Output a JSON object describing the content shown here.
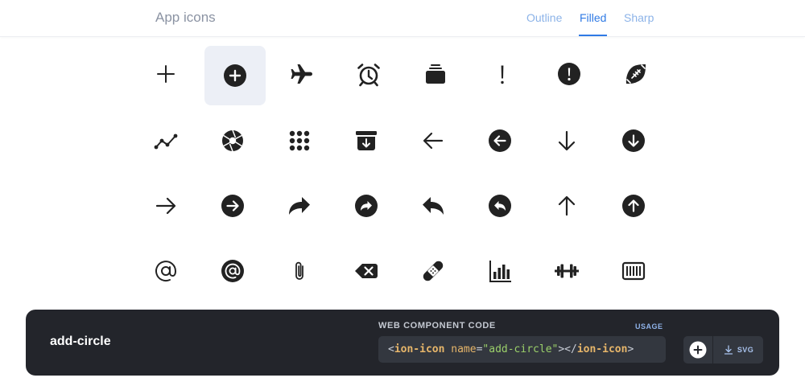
{
  "header": {
    "title": "App icons",
    "tabs": [
      {
        "label": "Outline",
        "active": false
      },
      {
        "label": "Filled",
        "active": true
      },
      {
        "label": "Sharp",
        "active": false
      }
    ]
  },
  "grid": {
    "selected_index": 1,
    "icons": [
      "add-icon",
      "add-circle-icon",
      "airplane-icon",
      "alarm-icon",
      "albums-icon",
      "alert-icon",
      "alert-circle-icon",
      "american-football-icon",
      "analytics-icon",
      "aperture-icon",
      "apps-icon",
      "archive-icon",
      "arrow-back-icon",
      "arrow-back-circle-icon",
      "arrow-down-icon",
      "arrow-down-circle-icon",
      "arrow-forward-icon",
      "arrow-forward-circle-icon",
      "arrow-redo-icon",
      "arrow-redo-circle-icon",
      "arrow-undo-icon",
      "arrow-undo-circle-icon",
      "arrow-up-icon",
      "arrow-up-circle-icon",
      "at-icon",
      "at-circle-icon",
      "attach-icon",
      "backspace-icon",
      "bandage-icon",
      "bar-chart-icon",
      "barbell-icon",
      "barcode-icon"
    ]
  },
  "detail": {
    "icon_name": "add-circle",
    "code_label": "WEB COMPONENT CODE",
    "usage_label": "USAGE",
    "code": {
      "open_bracket": "<",
      "tag": "ion-icon",
      "attr": "name",
      "equals": "=",
      "value": "\"add-circle\"",
      "close_open": "></",
      "close_tag": "ion-icon",
      "close_bracket": ">"
    },
    "download_label": "SVG"
  },
  "colors": {
    "accent": "#2f7ae5",
    "icon": "#222222",
    "panel_bg": "#23252b",
    "selected_bg": "#eceff6"
  }
}
